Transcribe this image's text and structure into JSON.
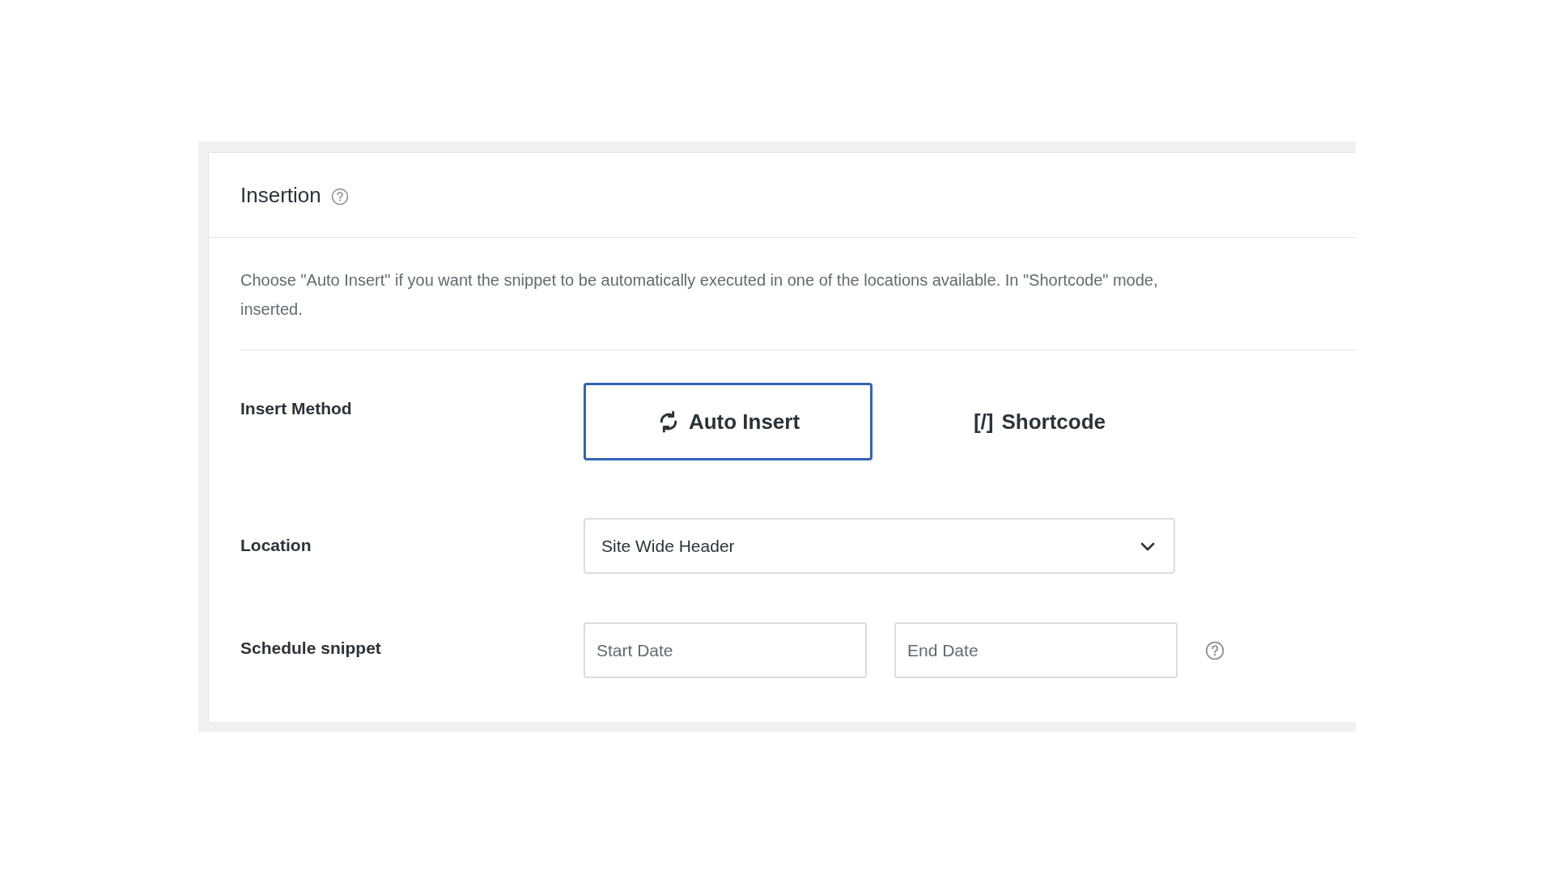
{
  "panel": {
    "title": "Insertion",
    "description_lines": [
      "Choose \"Auto Insert\" if you want the snippet to be automatically executed in one of the locations available. In \"Shortcode\" mode,",
      "inserted."
    ],
    "fields": [
      {
        "kind": "method",
        "label": "Insert Method",
        "options": [
          {
            "kind": "auto",
            "label": "Auto Insert",
            "selected": true
          },
          {
            "kind": "shortcode",
            "icon_text": "[/]",
            "label": "Shortcode",
            "selected": false
          }
        ]
      },
      {
        "kind": "select",
        "label": "Location",
        "value": "Site Wide Header"
      },
      {
        "kind": "dates",
        "label": "Schedule snippet",
        "placeholders": [
          "Start Date",
          "End Date"
        ]
      }
    ]
  }
}
